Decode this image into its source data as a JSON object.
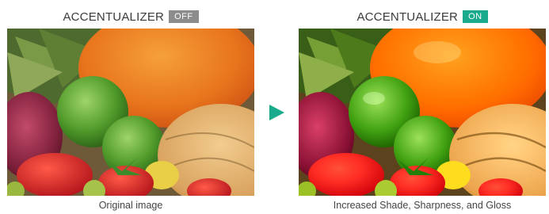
{
  "left": {
    "title": "ACCENTUALIZER",
    "badge": "OFF",
    "badge_color": "#8c8c8c",
    "caption": "Original image"
  },
  "right": {
    "title": "ACCENTUALIZER",
    "badge": "ON",
    "badge_color": "#1aaa8c",
    "caption": "Increased Shade, Sharpness, and Gloss"
  },
  "arrow": {
    "icon": "play-arrow-icon",
    "color": "#1aaa8c"
  }
}
